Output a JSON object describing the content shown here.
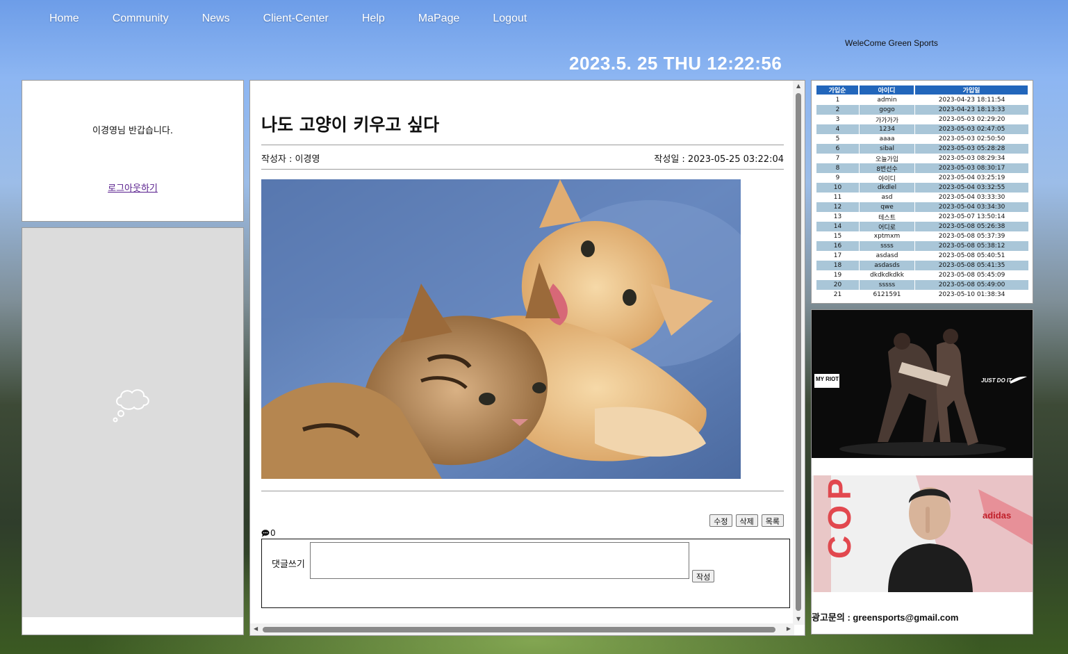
{
  "nav": {
    "items": [
      {
        "label": "Home"
      },
      {
        "label": "Community"
      },
      {
        "label": "News"
      },
      {
        "label": "Client-Center"
      },
      {
        "label": "Help"
      },
      {
        "label": "MaPage"
      },
      {
        "label": "Logout"
      }
    ]
  },
  "header": {
    "welcome": "WeleCome Green Sports",
    "clock": "2023.5. 25 THU 12:22:56"
  },
  "login": {
    "greeting": "이경영님 반갑습니다.",
    "logout_link": "로그아웃하기"
  },
  "post": {
    "title": "나도 고양이 키우고 싶다",
    "author": "작성자 : 이경영",
    "date": "작성일 : 2023-05-25 03:22:04",
    "edit_label": "수정",
    "delete_label": "삭제",
    "list_label": "목록",
    "comment_count": "0",
    "comment_label": "댓글쓰기",
    "submit_label": "작성"
  },
  "members": {
    "headers": [
      "가입순",
      "아이디",
      "가입일"
    ],
    "rows": [
      [
        "1",
        "admin",
        "2023-04-23 18:11:54"
      ],
      [
        "2",
        "gogo",
        "2023-04-23 18:13:33"
      ],
      [
        "3",
        "가가가가",
        "2023-05-03 02:29:20"
      ],
      [
        "4",
        "1234",
        "2023-05-03 02:47:05"
      ],
      [
        "5",
        "aaaa",
        "2023-05-03 02:50:50"
      ],
      [
        "6",
        "sibal",
        "2023-05-03 05:28:28"
      ],
      [
        "7",
        "오늘가입",
        "2023-05-03 08:29:34"
      ],
      [
        "8",
        "8번선수",
        "2023-05-03 08:30:17"
      ],
      [
        "9",
        "아이디",
        "2023-05-04 03:25:19"
      ],
      [
        "10",
        "dkdlel",
        "2023-05-04 03:32:55"
      ],
      [
        "11",
        "asd",
        "2023-05-04 03:33:30"
      ],
      [
        "12",
        "qwe",
        "2023-05-04 03:34:30"
      ],
      [
        "13",
        "테스트",
        "2023-05-07 13:50:14"
      ],
      [
        "14",
        "어디로",
        "2023-05-08 05:26:38"
      ],
      [
        "15",
        "xptmxm",
        "2023-05-08 05:37:39"
      ],
      [
        "16",
        "ssss",
        "2023-05-08 05:38:12"
      ],
      [
        "17",
        "asdasd",
        "2023-05-08 05:40:51"
      ],
      [
        "18",
        "asdasds",
        "2023-05-08 05:41:35"
      ],
      [
        "19",
        "dkdkdkdkk",
        "2023-05-08 05:45:09"
      ],
      [
        "20",
        "sssss",
        "2023-05-08 05:49:00"
      ],
      [
        "21",
        "6121591",
        "2023-05-10 01:38:34"
      ]
    ]
  },
  "ads": {
    "ad1_left": "MY RIOT",
    "ad1_right": "JUST DO IT",
    "ad2_word": "COPA",
    "ad2_brand": "adidas",
    "contact": "광고문의 : greensports@gmail.com"
  },
  "colors": {
    "table_header": "#2266bb",
    "table_stripe": "#a9c6d8",
    "link_visited": "#551a8b"
  }
}
